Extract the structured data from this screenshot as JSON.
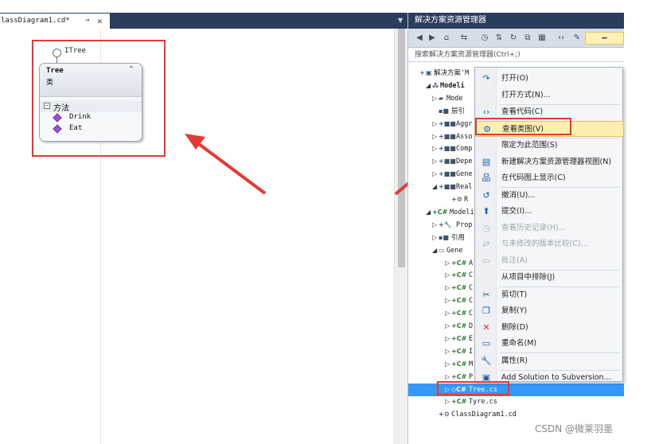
{
  "document_tab": {
    "title": "lassDiagram1.cd*",
    "pin": "⊸",
    "close": "✕"
  },
  "class_diagram": {
    "interface_name": "ITree",
    "class_name": "Tree",
    "class_kind": "类",
    "collapse_glyph": "⌃",
    "section_label": "方法",
    "section_toggle": "−",
    "methods": [
      "Drink",
      "Eat"
    ]
  },
  "solution_explorer": {
    "title": "解决方案资源管理器",
    "search_placeholder": "搜索解决方案资源管理器(Ctrl+;)",
    "toolbar_icons": [
      "back-icon",
      "forward-icon",
      "home-icon",
      "sync-icon",
      "history-icon",
      "pending-changes-icon",
      "refresh-icon",
      "collapse-all-icon",
      "show-all-files-icon",
      "view-code-icon",
      "properties-icon",
      "preview-icon"
    ],
    "tree": [
      {
        "expander": "+",
        "icon": "▣",
        "text": "解决方案'M",
        "indent": 0
      },
      {
        "expander": "◢",
        "icon": "⁂",
        "text": "Modeli",
        "indent": 1,
        "bold": true
      },
      {
        "expander": "▷",
        "icon": "▰",
        "text": "Mode",
        "indent": 2
      },
      {
        "expander": "",
        "icon": "▪■",
        "text": "层引",
        "indent": 2
      },
      {
        "expander": "▷",
        "icon": "+■■",
        "text": "Aggr",
        "indent": 2
      },
      {
        "expander": "▷",
        "icon": "+■■",
        "text": "Asso",
        "indent": 2
      },
      {
        "expander": "▷",
        "icon": "+■■",
        "text": "Comp",
        "indent": 2
      },
      {
        "expander": "▷",
        "icon": "+■■",
        "text": "Depe",
        "indent": 2
      },
      {
        "expander": "▷",
        "icon": "+■■",
        "text": "Gene",
        "indent": 2
      },
      {
        "expander": "◢",
        "icon": "+■■",
        "text": "Real",
        "indent": 2
      },
      {
        "expander": "",
        "icon": "+⚙",
        "text": "R",
        "indent": 3
      },
      {
        "expander": "◢",
        "icon": "+C#",
        "text": "Modelin",
        "indent": 1
      },
      {
        "expander": "▷",
        "icon": "+🔧",
        "text": "Prop",
        "indent": 2
      },
      {
        "expander": "▷",
        "icon": "▪■",
        "text": "引用",
        "indent": 2
      },
      {
        "expander": "◢",
        "icon": "▭",
        "text": "Gene",
        "indent": 2
      },
      {
        "expander": "▷",
        "icon": "+C#",
        "text": "A",
        "indent": 3
      },
      {
        "expander": "▷",
        "icon": "+C#",
        "text": "C",
        "indent": 3
      },
      {
        "expander": "▷",
        "icon": "+C#",
        "text": "C",
        "indent": 3
      },
      {
        "expander": "▷",
        "icon": "+C#",
        "text": "C",
        "indent": 3
      },
      {
        "expander": "▷",
        "icon": "+C#",
        "text": "C",
        "indent": 3
      },
      {
        "expander": "▷",
        "icon": "+C#",
        "text": "D",
        "indent": 3
      },
      {
        "expander": "▷",
        "icon": "+C#",
        "text": "E",
        "indent": 3
      },
      {
        "expander": "▷",
        "icon": "+C#",
        "text": "I",
        "indent": 3
      },
      {
        "expander": "▷",
        "icon": "+C#",
        "text": "M",
        "indent": 3
      },
      {
        "expander": "▷",
        "icon": "+C#",
        "text": "P",
        "indent": 3
      },
      {
        "expander": "▷",
        "icon": "◇C#",
        "text": "Tree.cs",
        "indent": 3,
        "selected": true
      },
      {
        "expander": "▷",
        "icon": "+C#",
        "text": "Tyre.cs",
        "indent": 3
      },
      {
        "expander": "",
        "icon": "+⚙",
        "text": "ClassDiagram1.cd",
        "indent": 2
      }
    ]
  },
  "context_menu": {
    "items": [
      {
        "label": "打开(O)",
        "icon": "open-icon",
        "glyph": "↷"
      },
      {
        "label": "打开方式(N)...",
        "icon": "",
        "glyph": ""
      },
      {
        "sep": true
      },
      {
        "label": "查看代码(C)",
        "icon": "view-code-icon",
        "glyph": "‹›"
      },
      {
        "label": "查看类图(V)",
        "icon": "class-diagram-icon",
        "glyph": "⚙",
        "highlight": true
      },
      {
        "sep": true
      },
      {
        "label": "限定为此范围(S)",
        "icon": "",
        "glyph": ""
      },
      {
        "label": "新建解决方案资源管理器视图(N)",
        "icon": "new-view-icon",
        "glyph": "▤"
      },
      {
        "label": "在代码图上显示(C)",
        "icon": "code-map-icon",
        "glyph": "品"
      },
      {
        "sep": true
      },
      {
        "label": "撤消(U)...",
        "icon": "undo-icon",
        "glyph": "↺"
      },
      {
        "label": "提交(I)...",
        "icon": "commit-icon",
        "glyph": "⬆"
      },
      {
        "label": "查看历史记录(H)...",
        "icon": "history-icon",
        "glyph": "◷",
        "disabled": true
      },
      {
        "label": "与未修改的版本比较(C)...",
        "icon": "compare-icon",
        "glyph": "⇄",
        "disabled": true
      },
      {
        "label": "批注(A)",
        "icon": "annotate-icon",
        "glyph": "▭",
        "disabled": true
      },
      {
        "sep": true
      },
      {
        "label": "从项目中排除(J)",
        "icon": "",
        "glyph": ""
      },
      {
        "sep": true
      },
      {
        "label": "剪切(T)",
        "icon": "cut-icon",
        "glyph": "✂"
      },
      {
        "label": "复制(Y)",
        "icon": "copy-icon",
        "glyph": "❐"
      },
      {
        "label": "删除(D)",
        "icon": "delete-icon",
        "glyph": "✕",
        "red": true
      },
      {
        "label": "重命名(M)",
        "icon": "rename-icon",
        "glyph": "▭"
      },
      {
        "sep": true
      },
      {
        "label": "属性(R)",
        "icon": "properties-icon",
        "glyph": "🔧"
      },
      {
        "sep": true
      },
      {
        "label": "Add Solution to Subversion...",
        "icon": "subversion-icon",
        "glyph": "▣"
      }
    ]
  },
  "watermark": "CSDN @微莱羽墨",
  "colors": {
    "annotation_red": "#e53935",
    "title_bar": "#2b3d5d",
    "selection": "#3399ff",
    "menu_highlight": "#fcefb0"
  }
}
